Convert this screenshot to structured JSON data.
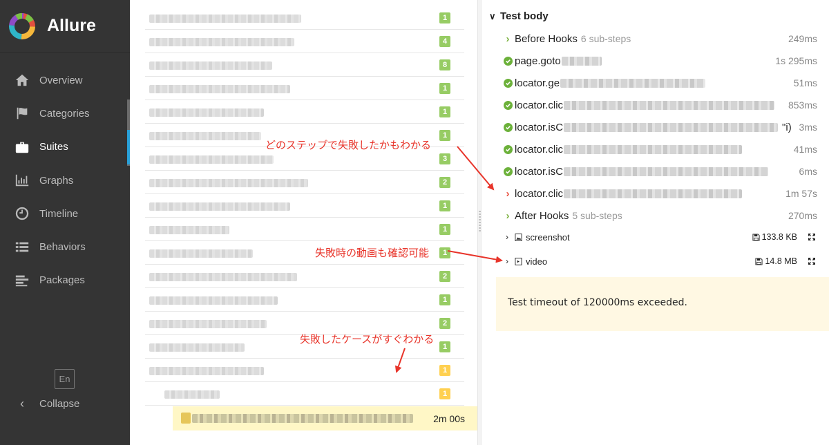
{
  "app": {
    "name": "Allure"
  },
  "sidebar": {
    "items": [
      {
        "label": "Overview",
        "icon": "home-icon",
        "active": false
      },
      {
        "label": "Categories",
        "icon": "flag-icon",
        "active": false
      },
      {
        "label": "Suites",
        "icon": "briefcase-icon",
        "active": true
      },
      {
        "label": "Graphs",
        "icon": "bar-chart-icon",
        "active": false
      },
      {
        "label": "Timeline",
        "icon": "clock-icon",
        "active": false
      },
      {
        "label": "Behaviors",
        "icon": "list-icon",
        "active": false
      },
      {
        "label": "Packages",
        "icon": "align-left-icon",
        "active": false
      }
    ],
    "language": "En",
    "collapse": "Collapse"
  },
  "tree": {
    "rows": [
      {
        "badge": "1",
        "status": "passed"
      },
      {
        "badge": "4",
        "status": "passed"
      },
      {
        "badge": "8",
        "status": "passed"
      },
      {
        "badge": "1",
        "status": "passed"
      },
      {
        "badge": "1",
        "status": "passed"
      },
      {
        "badge": "1",
        "status": "passed"
      },
      {
        "badge": "3",
        "status": "passed"
      },
      {
        "badge": "2",
        "status": "passed"
      },
      {
        "badge": "1",
        "status": "passed"
      },
      {
        "badge": "1",
        "status": "passed"
      },
      {
        "badge": "1",
        "status": "passed"
      },
      {
        "badge": "2",
        "status": "passed"
      },
      {
        "badge": "1",
        "status": "passed"
      },
      {
        "badge": "2",
        "status": "passed"
      },
      {
        "badge": "1",
        "status": "passed"
      },
      {
        "badge": "1",
        "status": "broken"
      },
      {
        "badge": "1",
        "status": "broken"
      }
    ],
    "selected_duration": "2m 00s"
  },
  "test_body": {
    "title": "Test body",
    "steps": [
      {
        "name": "Before Hooks",
        "sub": "6 sub-steps",
        "time": "249ms",
        "status": "group"
      },
      {
        "name": "page.goto",
        "time": "1s 295ms",
        "status": "passed"
      },
      {
        "name": "locator.ge",
        "time": "51ms",
        "status": "passed"
      },
      {
        "name": "locator.clic",
        "time": "853ms",
        "status": "passed"
      },
      {
        "name": "locator.isC",
        "suffix": "\"i)",
        "time": "3ms",
        "status": "passed"
      },
      {
        "name": "locator.clic",
        "time": "41ms",
        "status": "passed"
      },
      {
        "name": "locator.isC",
        "time": "6ms",
        "status": "passed"
      },
      {
        "name": "locator.clic",
        "time": "1m 57s",
        "status": "failed"
      },
      {
        "name": "After Hooks",
        "sub": "5 sub-steps",
        "time": "270ms",
        "status": "group"
      }
    ],
    "attachments": [
      {
        "name": "screenshot",
        "size": "133.8 KB",
        "icon": "image-file-icon"
      },
      {
        "name": "video",
        "size": "14.8 MB",
        "icon": "video-file-icon"
      }
    ],
    "error": "Test timeout of 120000ms exceeded."
  },
  "annotations": {
    "step_fail": "どのステップで失敗したかもわかる",
    "video": "失敗時の動画も確認可能",
    "case_fail": "失敗したケースがすぐわかる"
  },
  "colors": {
    "sidebar_bg": "#343434",
    "passed": "#97cc64",
    "broken": "#ffd050",
    "failed": "#e84d3c",
    "annotation": "#e8342a",
    "error_bg": "#fff8e3"
  }
}
